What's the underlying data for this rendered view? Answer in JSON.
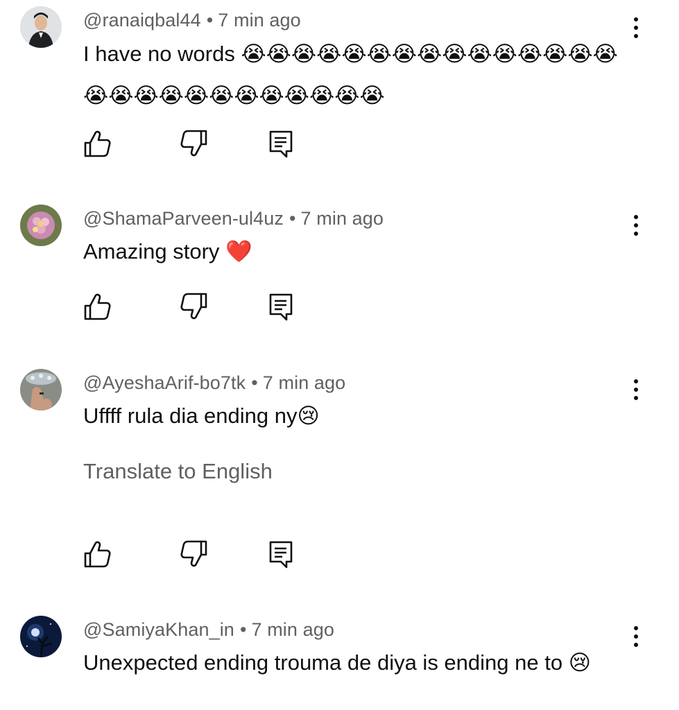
{
  "comments": [
    {
      "handle": "@ranaiqbal44",
      "time": "7 min ago",
      "text": "I have no words 😭😭😭😭😭😭😭😭😭😭😭😭😭😭😭😭😭😭😭😭😭😭😭😭😭😭😭",
      "avatar": "portrait-photo"
    },
    {
      "handle": "@ShamaParveen-ul4uz",
      "time": "7 min ago",
      "text": "Amazing story ❤️",
      "avatar": "flower-photo"
    },
    {
      "handle": "@AyeshaArif-bo7tk",
      "time": "7 min ago",
      "text": "Uffff rula dia ending ny😢",
      "translate": "Translate to English",
      "avatar": "hand-photo"
    },
    {
      "handle": "@SamiyaKhan_in",
      "time": "7 min ago",
      "text": "Unexpected ending trouma de diya is ending ne to 😢",
      "avatar": "night-sky-photo"
    }
  ],
  "separator": "•",
  "icons": {
    "like": "thumb-up-icon",
    "dislike": "thumb-down-icon",
    "reply": "reply-comment-icon",
    "more": "more-vertical-icon"
  },
  "colors": {
    "primary_text": "#0f0f0f",
    "secondary_text": "#606060",
    "background": "#ffffff"
  }
}
